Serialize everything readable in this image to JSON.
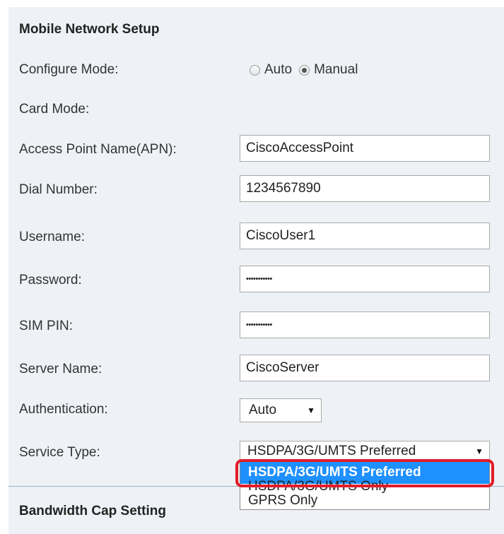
{
  "section": {
    "title": "Mobile Network Setup",
    "bandwidth_title": "Bandwidth Cap Setting"
  },
  "configure_mode": {
    "label": "Configure Mode:",
    "options": [
      "Auto",
      "Manual"
    ],
    "selected": "Manual"
  },
  "card_mode": {
    "label": "Card Mode:"
  },
  "apn": {
    "label": "Access Point Name(APN):",
    "value": "CiscoAccessPoint"
  },
  "dial_number": {
    "label": "Dial Number:",
    "value": "1234567890"
  },
  "username": {
    "label": "Username:",
    "value": "CiscoUser1"
  },
  "password": {
    "label": "Password:",
    "value": "•••••••••••"
  },
  "sim_pin": {
    "label": "SIM PIN:",
    "value": "•••••••••••"
  },
  "server_name": {
    "label": "Server Name:",
    "value": "CiscoServer"
  },
  "authentication": {
    "label": "Authentication:",
    "value": "Auto"
  },
  "service_type": {
    "label": "Service Type:",
    "value": "HSDPA/3G/UMTS Preferred",
    "options": [
      "HSDPA/3G/UMTS Preferred",
      "HSDPA/3G/UMTS Only",
      "GPRS Only"
    ]
  },
  "colors": {
    "panel_bg": "#eef2f6",
    "selected_option": "#1e90ff",
    "highlight": "#e11d2a"
  }
}
